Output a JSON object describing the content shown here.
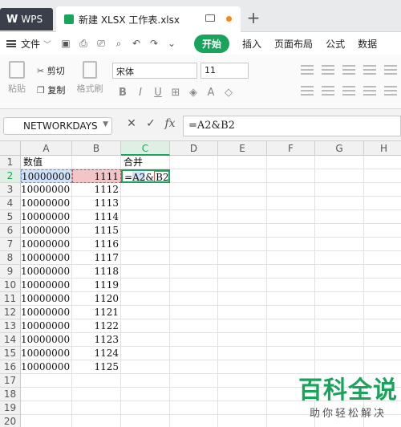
{
  "tabs": {
    "app_label": "WPS",
    "doc_label": "新建 XLSX 工作表.xlsx",
    "add": "+"
  },
  "menu": {
    "file": "文件",
    "file_caret": "﹀",
    "items": [
      "开始",
      "插入",
      "页面布局",
      "公式",
      "数据"
    ],
    "active": "开始",
    "accent": "#1aa35a"
  },
  "ribbon": {
    "paste": "粘贴",
    "cut": "剪切",
    "copy": "复制",
    "format_painter": "格式刷",
    "font_name": "宋体",
    "font_size": "11"
  },
  "formula_bar": {
    "name_box": "NETWORKDAYS",
    "cancel": "✕",
    "confirm": "✓",
    "fx": "fx",
    "formula": "=A2&B2"
  },
  "sheet": {
    "columns": [
      "A",
      "B",
      "C",
      "D",
      "E",
      "F",
      "G",
      "H"
    ],
    "active_column": "C",
    "rows": [
      "1",
      "2",
      "3",
      "4",
      "5",
      "6",
      "7",
      "8",
      "9",
      "10",
      "11",
      "12",
      "13",
      "14",
      "15",
      "16",
      "17",
      "18",
      "19",
      "20"
    ],
    "active_row": "2",
    "header": {
      "A": "数值",
      "B": "",
      "C": "合并"
    },
    "col_a": [
      "10000000",
      "10000000",
      "10000000",
      "10000000",
      "10000000",
      "10000000",
      "10000000",
      "10000000",
      "10000000",
      "10000000",
      "10000000",
      "10000000",
      "10000000",
      "10000000",
      "10000000"
    ],
    "col_b": [
      "1111",
      "1112",
      "1113",
      "1114",
      "1115",
      "1116",
      "1117",
      "1118",
      "1119",
      "1120",
      "1121",
      "1122",
      "1123",
      "1124",
      "1125"
    ],
    "c2_parts": {
      "eq": "=",
      "ref1": "A2",
      "amp": "&",
      "ref2": "B2"
    }
  },
  "watermark": {
    "main": "百科全说",
    "sub": "助你轻松解决"
  }
}
